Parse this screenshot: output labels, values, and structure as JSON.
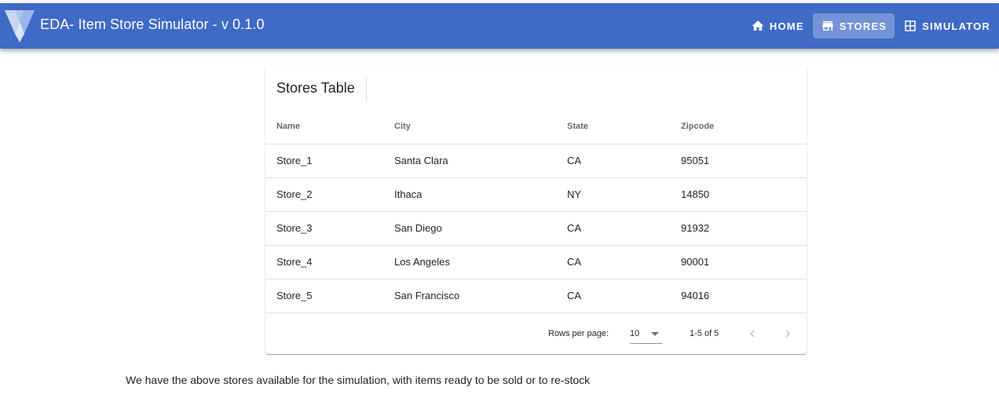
{
  "app": {
    "title": "EDA- Item Store Simulator - v 0.1.0",
    "brand_color": "#3f6ac6",
    "logo_icon": "vuetify-logo"
  },
  "nav": {
    "items": [
      {
        "label": "HOME",
        "icon": "home-icon",
        "active": false
      },
      {
        "label": "STORES",
        "icon": "store-icon",
        "active": true
      },
      {
        "label": "SIMULATOR",
        "icon": "table-icon",
        "active": false
      }
    ]
  },
  "stores_table": {
    "title": "Stores Table",
    "columns": [
      "Name",
      "City",
      "State",
      "Zipcode"
    ],
    "rows": [
      [
        "Store_1",
        "Santa Clara",
        "CA",
        "95051"
      ],
      [
        "Store_2",
        "Ithaca",
        "NY",
        "14850"
      ],
      [
        "Store_3",
        "San Diego",
        "CA",
        "91932"
      ],
      [
        "Store_4",
        "Los Angeles",
        "CA",
        "90001"
      ],
      [
        "Store_5",
        "San Francisco",
        "CA",
        "94016"
      ]
    ],
    "footer": {
      "rows_per_page_label": "Rows per page:",
      "rows_per_page_value": "10",
      "range_text": "1-5 of 5"
    }
  },
  "caption": "We have the above stores available for the simulation, with items ready to be sold or to re-stock"
}
